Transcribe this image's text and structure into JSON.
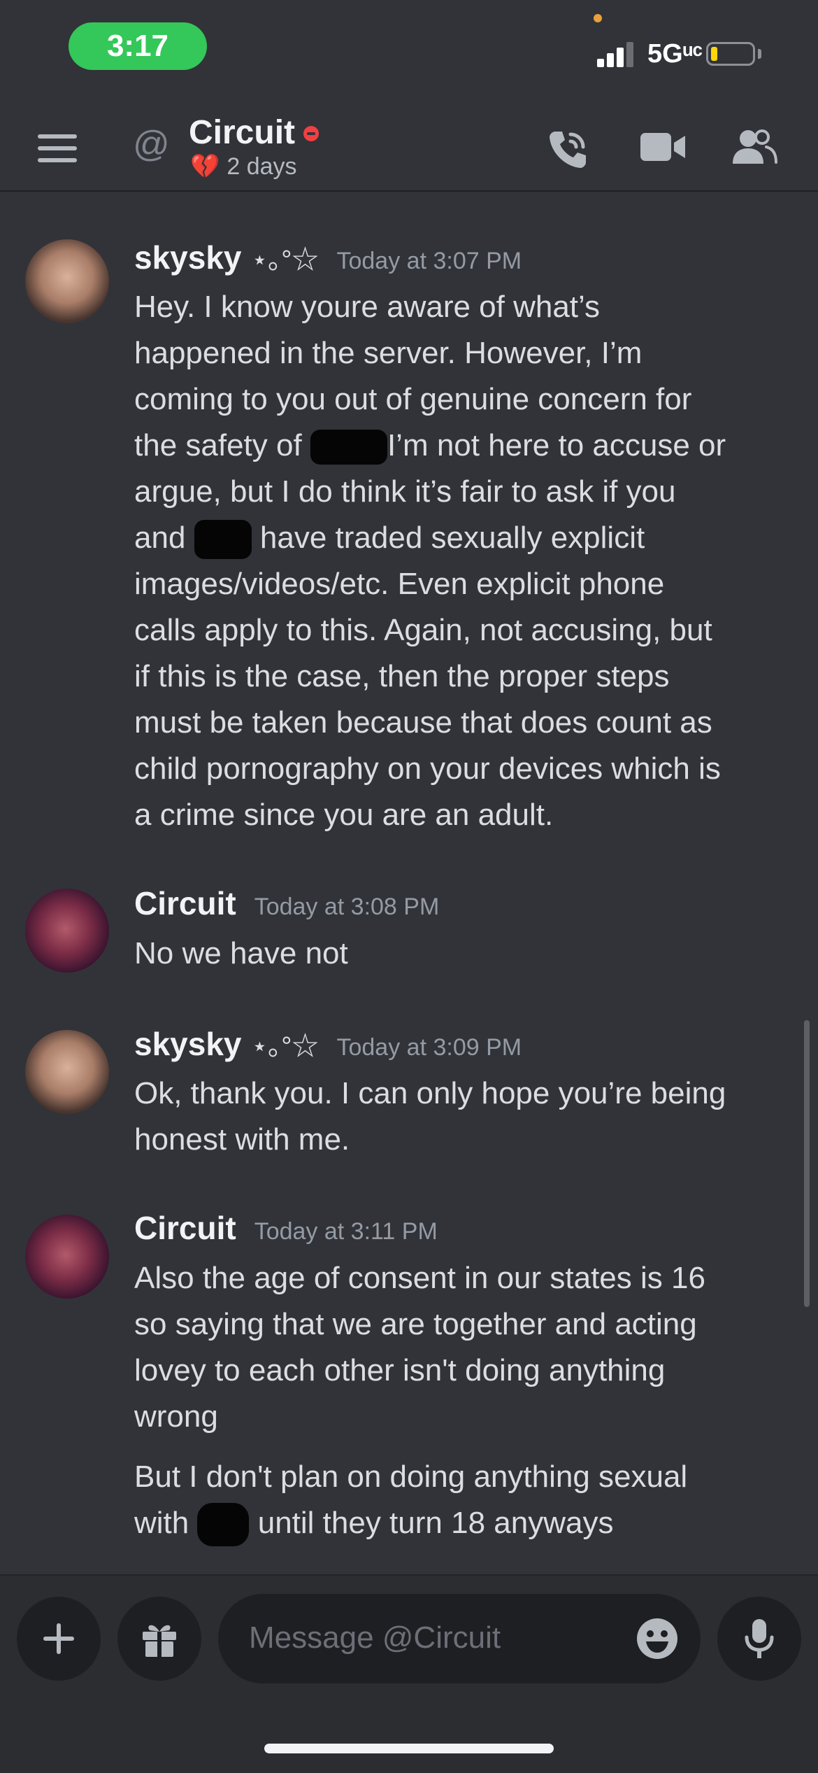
{
  "status_bar": {
    "time": "3:17",
    "network": "5Gᵘᶜ",
    "battery_level": 0.15
  },
  "header": {
    "channel_name": "Circuit",
    "status_text": "2 days",
    "status_emoji": "💔"
  },
  "messages": [
    {
      "author": "skysky",
      "author_deco": "⋆｡°☆",
      "timestamp": "Today at 3:07 PM",
      "lines": [
        "Hey. I know youre aware of what’s",
        "happened in the server. However, I’m",
        "coming to you out of genuine concern for",
        "the safety of",
        "I’m not here to accuse or",
        "argue, but I do think it’s fair to ask if you",
        "and",
        "have traded sexually explicit",
        "images/videos/etc. Even explicit phone",
        "calls apply to this. Again, not accusing, but",
        "if this is the case, then the proper steps",
        "must be taken because that does count as",
        "child pornography on your devices which is",
        "a crime since you are an adult."
      ]
    },
    {
      "author": "Circuit",
      "timestamp": "Today at 3:08 PM",
      "lines": [
        "No we have not"
      ]
    },
    {
      "author": "skysky",
      "author_deco": "⋆｡°☆",
      "timestamp": "Today at 3:09 PM",
      "lines": [
        "Ok, thank you. I can only hope you’re being",
        "honest with me."
      ]
    },
    {
      "author": "Circuit",
      "timestamp": "Today at 3:11 PM",
      "lines": [
        "Also the age of consent in our states is 16",
        "so saying that we are together and acting",
        "lovey to each other isn't doing anything",
        "wrong",
        "But I don't plan on doing anything sexual",
        "with",
        "until they turn 18 anyways"
      ]
    }
  ],
  "composer": {
    "placeholder": "Message @Circuit"
  },
  "icons": {
    "menu": "hamburger-menu-icon",
    "at": "at-sign-icon",
    "call": "phone-call-icon",
    "video": "video-camera-icon",
    "members": "members-icon",
    "add": "plus-icon",
    "gift": "gift-icon",
    "emoji": "emoji-icon",
    "mic": "microphone-icon"
  },
  "colors": {
    "background": "#313338",
    "status_pill": "#34c759",
    "dnd": "#f23f43",
    "battery": "#ffd60a"
  }
}
